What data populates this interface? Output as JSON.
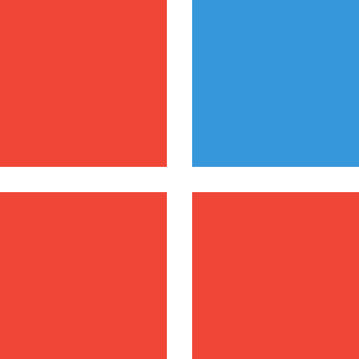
{
  "grid": {
    "background_color": "#ffffff",
    "tiles": [
      {
        "id": "top-left",
        "color": "#f04637"
      },
      {
        "id": "top-right",
        "color": "#3797db"
      },
      {
        "id": "bottom-left",
        "color": "#f04637"
      },
      {
        "id": "bottom-right",
        "color": "#f04637"
      }
    ]
  }
}
